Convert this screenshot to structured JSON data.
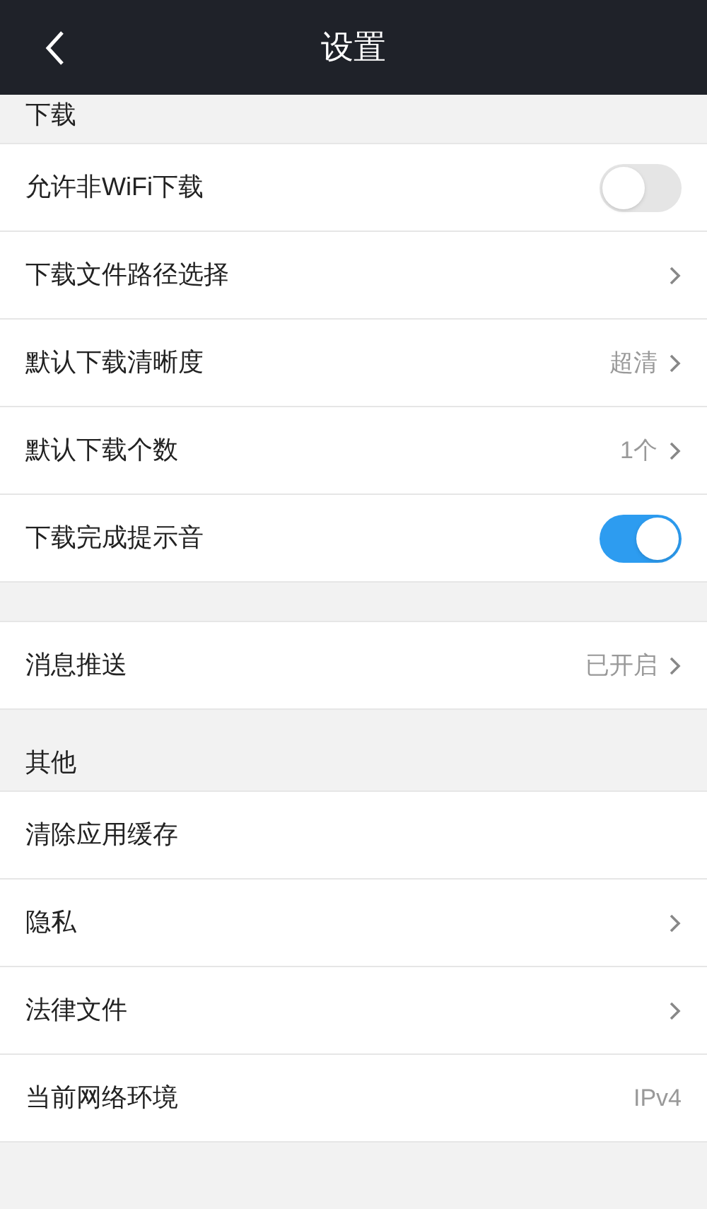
{
  "header": {
    "title": "设置"
  },
  "sections": [
    {
      "title": "下载",
      "rows": [
        {
          "kind": "toggle",
          "label": "允许非WiFi下载",
          "on": false
        },
        {
          "kind": "link",
          "label": "下载文件路径选择"
        },
        {
          "kind": "link",
          "label": "默认下载清晰度",
          "value": "超清"
        },
        {
          "kind": "link",
          "label": "默认下载个数",
          "value": "1个"
        },
        {
          "kind": "toggle",
          "label": "下载完成提示音",
          "on": true
        }
      ]
    },
    {
      "rows": [
        {
          "kind": "link",
          "label": "消息推送",
          "value": "已开启"
        }
      ]
    },
    {
      "title": "其他",
      "rows": [
        {
          "kind": "plain",
          "label": "清除应用缓存"
        },
        {
          "kind": "link",
          "label": "隐私"
        },
        {
          "kind": "link",
          "label": "法律文件"
        },
        {
          "kind": "plain",
          "label": "当前网络环境",
          "value": "IPv4"
        }
      ]
    }
  ]
}
